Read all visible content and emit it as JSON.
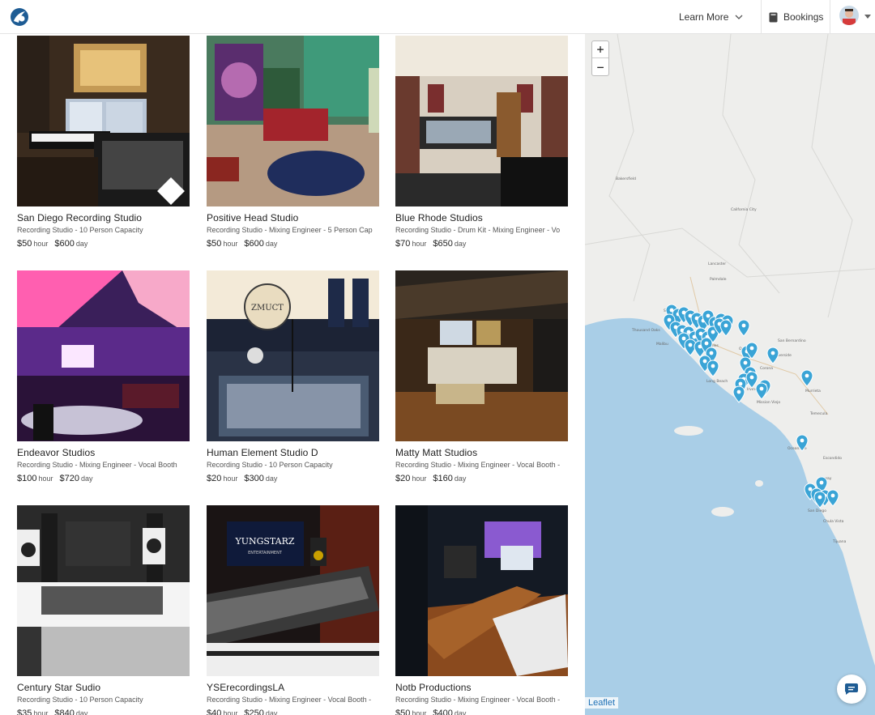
{
  "header": {
    "learn_more": "Learn More",
    "bookings": "Bookings"
  },
  "colors": {
    "water": "#a9cee7",
    "land": "#eeeeec",
    "pin": "#3aa4d6",
    "brand": "#1e5c94",
    "attribution": "#1c6fb5"
  },
  "listings": [
    {
      "title": "San Diego Recording Studio",
      "subtitle": "Recording Studio - 10 Person Capacity",
      "hour_price": "$50",
      "day_price": "$600",
      "hour_unit": "hour",
      "day_unit": "day"
    },
    {
      "title": "Positive Head Studio",
      "subtitle": "Recording Studio - Mixing Engineer - 5 Person Cap",
      "hour_price": "$50",
      "day_price": "$600",
      "hour_unit": "hour",
      "day_unit": "day"
    },
    {
      "title": "Blue Rhode Studios",
      "subtitle": "Recording Studio - Drum Kit - Mixing Engineer - Vo",
      "hour_price": "$70",
      "day_price": "$650",
      "hour_unit": "hour",
      "day_unit": "day"
    },
    {
      "title": "Endeavor Studios",
      "subtitle": "Recording Studio - Mixing Engineer - Vocal Booth",
      "hour_price": "$100",
      "day_price": "$720",
      "hour_unit": "hour",
      "day_unit": "day"
    },
    {
      "title": "Human Element Studio D",
      "subtitle": "Recording Studio - 10 Person Capacity",
      "hour_price": "$20",
      "day_price": "$300",
      "hour_unit": "hour",
      "day_unit": "day"
    },
    {
      "title": "Matty Matt Studios",
      "subtitle": "Recording Studio - Mixing Engineer - Vocal Booth -",
      "hour_price": "$20",
      "day_price": "$160",
      "hour_unit": "hour",
      "day_unit": "day"
    },
    {
      "title": "Century Star Sudio",
      "subtitle": "Recording Studio - 10 Person Capacity",
      "hour_price": "$35",
      "day_price": "$840",
      "hour_unit": "hour",
      "day_unit": "day"
    },
    {
      "title": "YSErecordingsLA",
      "subtitle": "Recording Studio - Mixing Engineer - Vocal Booth -",
      "hour_price": "$40",
      "day_price": "$250",
      "hour_unit": "hour",
      "day_unit": "day"
    },
    {
      "title": "Notb Productions",
      "subtitle": "Recording Studio - Mixing Engineer - Vocal Booth -",
      "hour_price": "$50",
      "day_price": "$400",
      "hour_unit": "hour",
      "day_unit": "day"
    }
  ],
  "photo_text": {
    "zmuct": "ZMUCT",
    "yungstarz": "YUNGSTARZ",
    "entertainment": "ENTERTAINMENT"
  },
  "map": {
    "zoom_in": "+",
    "zoom_out": "−",
    "attribution": "Leaflet",
    "labels": [
      "Bakersfield",
      "California City",
      "Lancaster",
      "Palmdale",
      "Santa Clarita",
      "Thousand Oaks",
      "Malibu",
      "Los Angeles",
      "Long Beach",
      "Ontario",
      "San Bernardino",
      "Riverside",
      "Corona",
      "Irvine",
      "Mission Viejo",
      "Temecula",
      "Murrieta",
      "Oceanside",
      "Escondido",
      "Poway",
      "San Diego",
      "Chula Vista",
      "Tijuana"
    ]
  }
}
